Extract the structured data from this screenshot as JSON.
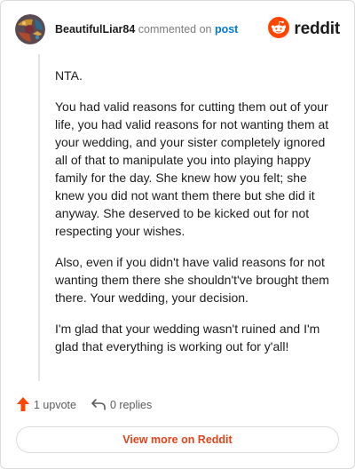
{
  "header": {
    "username": "BeautifulLiar84",
    "action_text": " commented on ",
    "post_link": "post",
    "brand": "reddit"
  },
  "comment": {
    "paragraphs": [
      "NTA.",
      "You had valid reasons for cutting them out of your life, you had valid reasons for not wanting them at your wedding, and your sister completely ignored all of that to manipulate you into playing happy family for the day. She knew how you felt; she knew you did not want them there but she did it anyway. She deserved to be kicked out for not respecting your wishes.",
      "Also, even if you didn't have valid reasons for not wanting them there she shouldn't've brought them there. Your wedding, your decision.",
      "I'm glad that your wedding wasn't ruined and I'm glad that everything is working out for y'all!"
    ]
  },
  "actions": {
    "upvote_label": "1 upvote",
    "replies_label": "0 replies"
  },
  "footer": {
    "view_more_label": "View more on Reddit"
  },
  "colors": {
    "brand_orange": "#ff4500",
    "link_blue": "#0079d3",
    "view_more_text": "#e0451b"
  },
  "icons": {
    "avatar": "user-avatar",
    "brand": "reddit-snoo-icon",
    "upvote": "upvote-arrow-icon",
    "reply": "reply-arrow-icon"
  }
}
